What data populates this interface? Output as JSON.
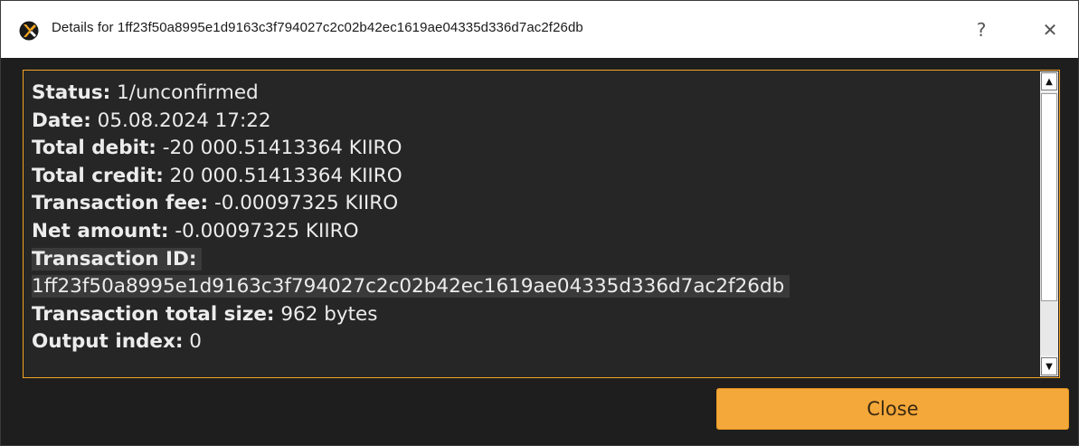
{
  "window": {
    "title": "Details for 1ff23f50a8995e1d9163c3f794027c2c02b42ec1619ae04335d336d7ac2f26db",
    "help_glyph": "?",
    "close_glyph": "✕"
  },
  "details": {
    "status_label": "Status:",
    "status_value": "1/unconfirmed",
    "date_label": "Date:",
    "date_value": "05.08.2024 17:22",
    "total_debit_label": "Total debit:",
    "total_debit_value": "-20 000.51413364 KIIRO",
    "total_credit_label": "Total credit:",
    "total_credit_value": "20 000.51413364 KIIRO",
    "fee_label": "Transaction fee:",
    "fee_value": "-0.00097325 KIIRO",
    "net_label": "Net amount:",
    "net_value": "-0.00097325 KIIRO",
    "txid_label": "Transaction ID:",
    "txid_value": "1ff23f50a8995e1d9163c3f794027c2c02b42ec1619ae04335d336d7ac2f26db",
    "size_label": "Transaction total size:",
    "size_value": "962 bytes",
    "output_index_label": "Output index:",
    "output_index_value": "0"
  },
  "scrollbar": {
    "up_glyph": "▲",
    "down_glyph": "▼"
  },
  "buttons": {
    "close_label": "Close"
  },
  "colors": {
    "accent": "#f5a623",
    "background": "#1e1e1e",
    "text": "#ececec"
  },
  "icons": {
    "app": "kiirocoin-logo-icon"
  }
}
